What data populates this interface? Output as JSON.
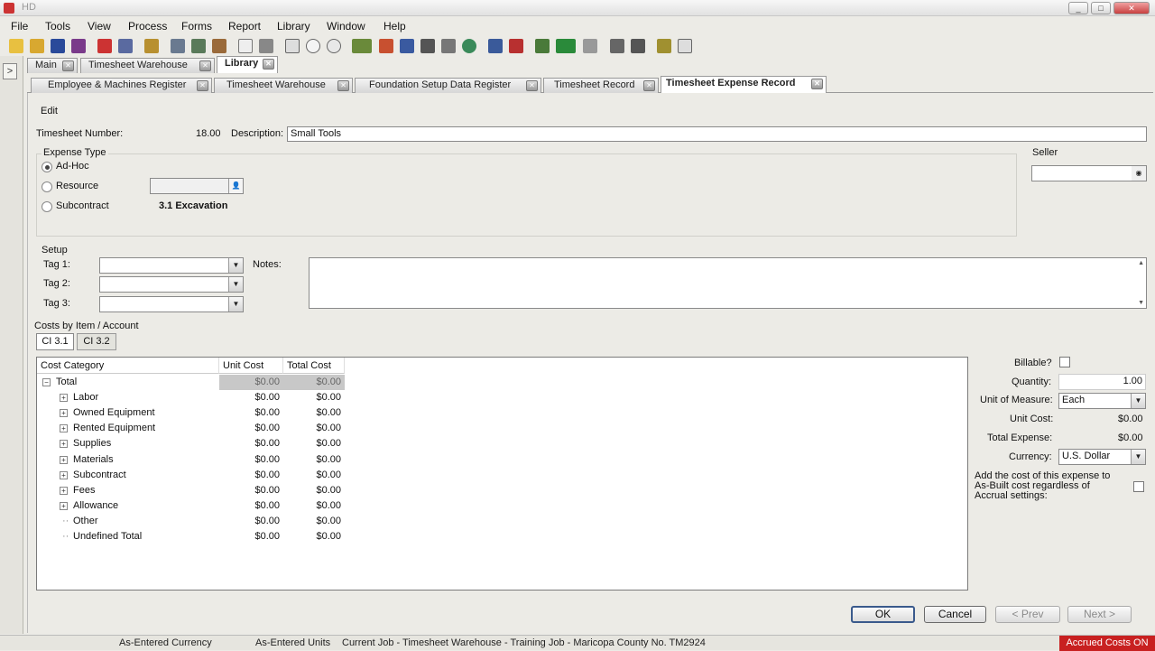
{
  "window": {
    "title": "HD"
  },
  "menu": [
    "File",
    "Tools",
    "View",
    "Process",
    "Forms",
    "Report",
    "Library",
    "Window",
    "Help"
  ],
  "tabs_top": [
    "Main",
    "Timesheet Warehouse",
    "Library"
  ],
  "tabs_sub": [
    "Employee & Machines Register",
    "Timesheet Warehouse",
    "Foundation Setup Data Register",
    "Timesheet Record",
    "Timesheet Expense Record"
  ],
  "form": {
    "edit_label": "Edit",
    "timesheet_number_label": "Timesheet Number:",
    "timesheet_number": "18.00",
    "description_label": "Description:",
    "description": "Small Tools",
    "expense_type_label": "Expense Type",
    "ad_hoc": "Ad-Hoc",
    "resource": "Resource",
    "subcontract": "Subcontract",
    "subcontract_value": "3.1 Excavation",
    "seller_label": "Seller",
    "setup_label": "Setup",
    "tag1": "Tag 1:",
    "tag2": "Tag 2:",
    "tag3": "Tag 3:",
    "notes": "Notes:",
    "costs_label": "Costs by Item / Account",
    "ci_tabs": [
      "CI  3.1",
      "CI  3.2"
    ]
  },
  "grid": {
    "headers": [
      "Cost Category",
      "Unit Cost",
      "Total Cost"
    ],
    "rows": [
      {
        "name": "Total",
        "unit": "$0.00",
        "total": "$0.00"
      },
      {
        "name": "Labor",
        "unit": "$0.00",
        "total": "$0.00"
      },
      {
        "name": "Owned  Equipment",
        "unit": "$0.00",
        "total": "$0.00"
      },
      {
        "name": "Rented  Equipment",
        "unit": "$0.00",
        "total": "$0.00"
      },
      {
        "name": "Supplies",
        "unit": "$0.00",
        "total": "$0.00"
      },
      {
        "name": "Materials",
        "unit": "$0.00",
        "total": "$0.00"
      },
      {
        "name": "Subcontract",
        "unit": "$0.00",
        "total": "$0.00"
      },
      {
        "name": "Fees",
        "unit": "$0.00",
        "total": "$0.00"
      },
      {
        "name": "Allowance",
        "unit": "$0.00",
        "total": "$0.00"
      },
      {
        "name": "Other",
        "unit": "$0.00",
        "total": "$0.00"
      },
      {
        "name": "Undefined  Total",
        "unit": "$0.00",
        "total": "$0.00"
      }
    ]
  },
  "right": {
    "billable": "Billable?",
    "quantity_label": "Quantity:",
    "quantity": "1.00",
    "uom_label": "Unit of Measure:",
    "uom": "Each",
    "unit_cost_label": "Unit Cost:",
    "unit_cost": "$0.00",
    "total_expense_label": "Total Expense:",
    "total_expense": "$0.00",
    "currency_label": "Currency:",
    "currency": "U.S. Dollar",
    "asbuilt_1": "Add the cost of this expense to",
    "asbuilt_2": "As-Built cost regardless of",
    "asbuilt_3": "Accrual settings:"
  },
  "buttons": {
    "ok": "OK",
    "cancel": "Cancel",
    "prev": "< Prev",
    "next": "Next >"
  },
  "status": {
    "currency": "As-Entered Currency",
    "units": "As-Entered Units",
    "job": "Current Job - Timesheet Warehouse - Training Job - Maricopa County No. TM2924",
    "accrued": "Accrued Costs ON"
  }
}
